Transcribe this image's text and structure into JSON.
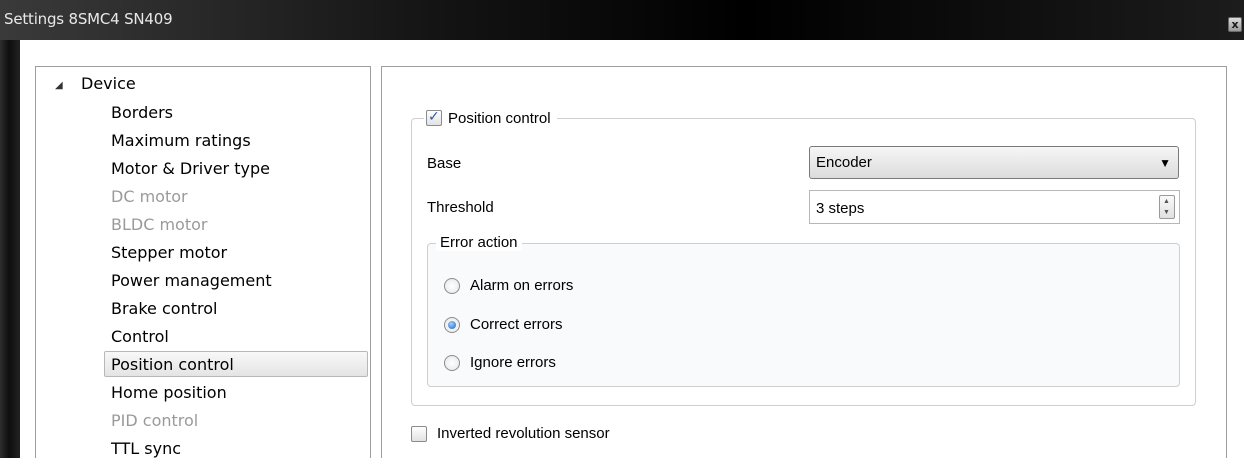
{
  "window": {
    "title": "Settings 8SMC4 SN409",
    "close_label": "x"
  },
  "tree": {
    "root_arrow": "◢",
    "root_label": "Device",
    "items": [
      {
        "label": "Borders",
        "disabled": false,
        "selected": false
      },
      {
        "label": "Maximum ratings",
        "disabled": false,
        "selected": false
      },
      {
        "label": "Motor & Driver type",
        "disabled": false,
        "selected": false
      },
      {
        "label": "DC motor",
        "disabled": true,
        "selected": false
      },
      {
        "label": "BLDC motor",
        "disabled": true,
        "selected": false
      },
      {
        "label": "Stepper motor",
        "disabled": false,
        "selected": false
      },
      {
        "label": "Power management",
        "disabled": false,
        "selected": false
      },
      {
        "label": "Brake control",
        "disabled": false,
        "selected": false
      },
      {
        "label": "Control",
        "disabled": false,
        "selected": false
      },
      {
        "label": "Position control",
        "disabled": false,
        "selected": true
      },
      {
        "label": "Home position",
        "disabled": false,
        "selected": false
      },
      {
        "label": "PID control",
        "disabled": true,
        "selected": false
      },
      {
        "label": "TTL sync",
        "disabled": false,
        "selected": false
      }
    ]
  },
  "position_control": {
    "checkbox_label": "Position control",
    "checked": true,
    "base_label": "Base",
    "base_value": "Encoder",
    "threshold_label": "Threshold",
    "threshold_value": "3 steps",
    "error_action": {
      "title": "Error action",
      "options": [
        {
          "label": "Alarm on errors",
          "selected": false
        },
        {
          "label": "Correct errors",
          "selected": true
        },
        {
          "label": "Ignore errors",
          "selected": false
        }
      ]
    }
  },
  "inverted_sensor": {
    "label": "Inverted revolution sensor",
    "checked": false
  },
  "colors": {
    "selection_bg": "#e8e8e8",
    "disabled_text": "#9a9a9a",
    "radio_accent": "#1b5fb8"
  }
}
